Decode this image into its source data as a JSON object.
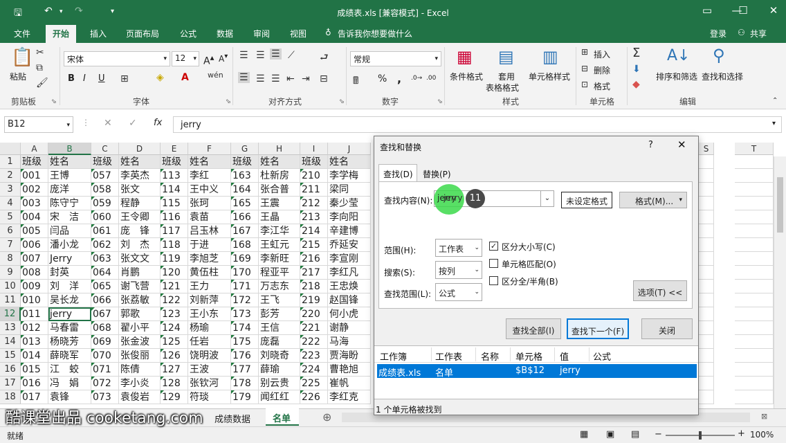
{
  "title": "成绩表.xls  [兼容模式] - Excel",
  "tabs": [
    "文件",
    "开始",
    "插入",
    "页面布局",
    "公式",
    "数据",
    "审阅",
    "视图"
  ],
  "tell_me": "告诉我你想要做什么",
  "login": "登录",
  "share": "共享",
  "ribbon": {
    "paste": "粘贴",
    "clipboard": "剪贴板",
    "font_name": "宋体",
    "font_size": "12",
    "font_group": "字体",
    "align_group": "对齐方式",
    "number_format": "常规",
    "number_group": "数字",
    "cond_format": "条件格式",
    "table_format_1": "套用",
    "table_format_2": "表格格式",
    "cell_style": "单元格样式",
    "styles_group": "样式",
    "insert": "插入",
    "delete": "删除",
    "format": "格式",
    "cells_group": "单元格",
    "sort_filter": "排序和筛选",
    "find_select": "查找和选择",
    "edit_group": "编辑",
    "bold": "B",
    "italic": "I",
    "underline": "U",
    "percent": "%",
    "comma": ","
  },
  "name_box": "B12",
  "formula": "jerry",
  "fx": "fx",
  "columns": [
    "A",
    "B",
    "C",
    "D",
    "E",
    "F",
    "G",
    "H",
    "I",
    "J",
    "S",
    "T"
  ],
  "header_row": [
    "班级",
    "姓名",
    "班级",
    "姓名",
    "班级",
    "姓名",
    "班级",
    "姓名",
    "班级",
    "姓名"
  ],
  "rows": [
    [
      "001",
      "王博",
      "057",
      "李英杰",
      "113",
      "李红",
      "163",
      "杜新房",
      "210",
      "李学梅"
    ],
    [
      "002",
      "庞洋",
      "058",
      "张文",
      "114",
      "王中义",
      "164",
      "张合普",
      "211",
      "梁同"
    ],
    [
      "003",
      "陈守宁",
      "059",
      "程静",
      "115",
      "张珂",
      "165",
      "王震",
      "212",
      "秦少莹"
    ],
    [
      "004",
      "宋　洁",
      "060",
      "王令卿",
      "116",
      "袁苗",
      "166",
      "王晶",
      "213",
      "李向阳"
    ],
    [
      "005",
      "闫品",
      "061",
      "庞　锋",
      "117",
      "吕玉林",
      "167",
      "李江华",
      "214",
      "辛建博"
    ],
    [
      "006",
      "潘小龙",
      "062",
      "刘　杰",
      "118",
      "于进",
      "168",
      "王虹元",
      "215",
      "乔延安"
    ],
    [
      "007",
      "Jerry",
      "063",
      "张文文",
      "119",
      "李旭芝",
      "169",
      "李新旺",
      "216",
      "李宣刚"
    ],
    [
      "008",
      "封英",
      "064",
      "肖鹏",
      "120",
      "黄伍柱",
      "170",
      "程亚平",
      "217",
      "李红凡"
    ],
    [
      "009",
      "刘　洋",
      "065",
      "谢飞营",
      "121",
      "王力",
      "171",
      "万志东",
      "218",
      "王忠焕"
    ],
    [
      "010",
      "吴长龙",
      "066",
      "张荔敏",
      "122",
      "刘新萍",
      "172",
      "王飞",
      "219",
      "赵国锋"
    ],
    [
      "011",
      "jerry",
      "067",
      "郭歌",
      "123",
      "王小东",
      "173",
      "彭芳",
      "220",
      "何小虎"
    ],
    [
      "012",
      "马春雷",
      "068",
      "翟小平",
      "124",
      "杨瑜",
      "174",
      "王信",
      "221",
      "谢静"
    ],
    [
      "013",
      "杨晓芳",
      "069",
      "张金波",
      "125",
      "任岩",
      "175",
      "庞磊",
      "222",
      "马海"
    ],
    [
      "014",
      "薛晓军",
      "070",
      "张俊丽",
      "126",
      "饶明波",
      "176",
      "刘晓奇",
      "223",
      "贾海盼"
    ],
    [
      "015",
      "江　蛟",
      "071",
      "陈倩",
      "127",
      "王波",
      "177",
      "薛瑜",
      "224",
      "曹艳旭"
    ],
    [
      "016",
      "冯　娟",
      "072",
      "李小炎",
      "128",
      "张钦河",
      "178",
      "别云贵",
      "225",
      "崔帆"
    ],
    [
      "017",
      "袁锋",
      "073",
      "袁俊岩",
      "129",
      "符琰",
      "179",
      "闻红红",
      "226",
      "李红克"
    ]
  ],
  "sheets": [
    "成绩数据",
    "名单"
  ],
  "status": "就绪",
  "zoom": "100%",
  "watermark": "酷课堂出品 cooketang.com",
  "dialog": {
    "title": "查找和替换",
    "help": "?",
    "tab_find": "查找(D)",
    "tab_replace": "替换(P)",
    "find_label": "查找内容(N):",
    "find_value": "jerry",
    "step_badge": "11",
    "no_format": "未设定格式",
    "format_btn": "格式(M)...",
    "scope_label": "范围(H):",
    "scope_value": "工作表",
    "search_label": "搜索(S):",
    "search_value": "按列",
    "lookin_label": "查找范围(L):",
    "lookin_value": "公式",
    "match_case": "区分大小写(C)",
    "match_cell": "单元格匹配(O)",
    "match_width": "区分全/半角(B)",
    "options_btn": "选项(T) <<",
    "find_all": "查找全部(I)",
    "find_next": "查找下一个(F)",
    "close": "关闭",
    "result_headers": [
      "工作簿",
      "工作表",
      "名称",
      "单元格",
      "值",
      "公式"
    ],
    "result": {
      "book": "成绩表.xls",
      "sheet": "名单",
      "name": "",
      "cell": "$B$12",
      "value": "jerry",
      "formula": ""
    },
    "status": "1 个单元格被找到"
  },
  "colors": {
    "excel_green": "#217346",
    "selected_row": "#0078d7",
    "spotlight": "#3bd94a"
  }
}
